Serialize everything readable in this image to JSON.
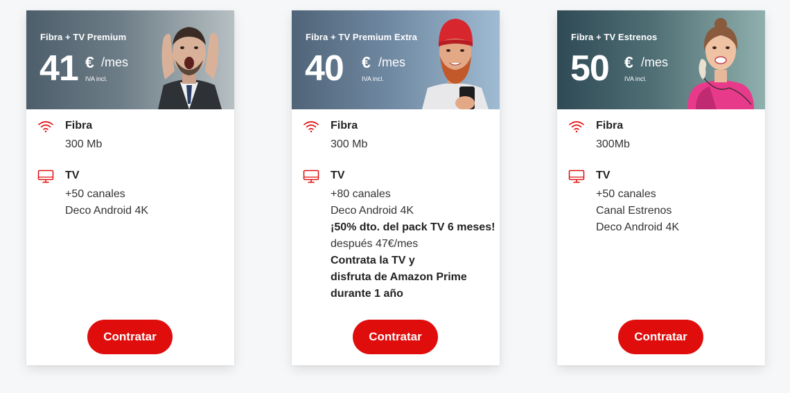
{
  "colors": {
    "accent": "#e00d0d",
    "background": "#f6f7f9",
    "card": "#ffffff"
  },
  "plans": [
    {
      "name": "Fibra + TV Premium",
      "price": "41",
      "currency": "€",
      "period": "/mes",
      "tax": "IVA incl.",
      "features": [
        {
          "icon": "wifi-icon",
          "title": "Fibra",
          "lines": [
            "300 Mb"
          ]
        },
        {
          "icon": "monitor-icon",
          "title": "TV",
          "lines": [
            "+50 canales",
            "Deco Android 4K"
          ]
        }
      ],
      "cta": "Contratar"
    },
    {
      "name": "Fibra + TV Premium Extra",
      "price": "40",
      "currency": "€",
      "period": "/mes",
      "tax": "IVA incl.",
      "features": [
        {
          "icon": "wifi-icon",
          "title": "Fibra",
          "lines": [
            "300 Mb"
          ]
        },
        {
          "icon": "monitor-icon",
          "title": "TV",
          "lines": [
            "+80 canales",
            "Deco Android 4K",
            "¡50% dto. del pack TV 6 meses!",
            "después 47€/mes",
            "Contrata la TV y",
            "disfruta de Amazon Prime",
            "durante 1 año"
          ]
        }
      ],
      "cta": "Contratar"
    },
    {
      "name": "Fibra + TV Estrenos",
      "price": "50",
      "currency": "€",
      "period": "/mes",
      "tax": "IVA incl.",
      "features": [
        {
          "icon": "wifi-icon",
          "title": "Fibra",
          "lines": [
            "300Mb"
          ]
        },
        {
          "icon": "monitor-icon",
          "title": "TV",
          "lines": [
            "+50 canales",
            "Canal Estrenos",
            "Deco Android 4K"
          ]
        }
      ],
      "cta": "Contratar"
    }
  ]
}
